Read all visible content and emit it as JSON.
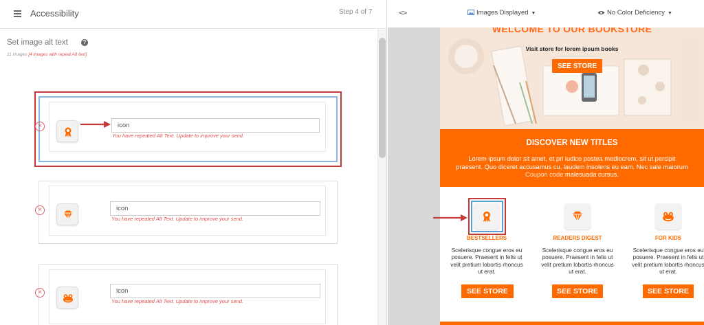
{
  "app": {
    "title": "Accessibility",
    "step": "Step 4 of 7"
  },
  "section": {
    "title": "Set image alt text",
    "count_label": "11 images",
    "count_warning": "[4 images with repeat Alt text]"
  },
  "images": [
    {
      "icon": "ribbon-award-icon",
      "alt_value": "icon",
      "error": "You have repeated Alt Text. Update to improve your send.",
      "active": true
    },
    {
      "icon": "diamond-icon",
      "alt_value": "icon",
      "error": "You have repeated Alt Text. Update to improve your send.",
      "active": false
    },
    {
      "icon": "frog-icon",
      "alt_value": "icon",
      "error": "You have repeated Alt Text. Update to improve your send.",
      "active": false
    }
  ],
  "preview_toolbar": {
    "code_toggle": "<>",
    "images_dropdown": "Images Displayed",
    "color_dropdown": "No Color Deficiency"
  },
  "email": {
    "hero_title": "WELCOME TO OUR BOOKSTORE",
    "hero_subtitle": "Visit store for lorem ipsum books",
    "hero_button": "SEE STORE",
    "discover_title": "DISCOVER NEW TITLES",
    "discover_body_pre": "Lorem ipsum dolor sit amet, et pri iudico postea mediocrem, sit ut percipit praesent. Quo diceret accusamus cu, laudem insolens eu eam. Nec sale maiorum ",
    "discover_coupon": "Coupon code",
    "discover_body_post": " malesuada cursus.",
    "products": [
      {
        "title": "BESTSELLERS",
        "desc": "Scelerisque congue eros eu posuere. Praesent in felis ut velit pretium lobortis rhoncus ut erat.",
        "button": "SEE STORE"
      },
      {
        "title": "READERS DIGEST",
        "desc": "Scelerisque congue eros eu posuere. Praesent in felis ut velit pretium lobortis rhoncus ut erat.",
        "button": "SEE STORE"
      },
      {
        "title": "FOR KIDS",
        "desc": "Scelerisque congue eros eu posuere. Praesent in felis ut velit pretium lobortis rhoncus ut erat.",
        "button": "SEE STORE"
      }
    ]
  },
  "colors": {
    "accent": "#ff6a00",
    "error": "#e05050",
    "highlight": "#c43a3a",
    "focus": "#8ab4e0"
  }
}
